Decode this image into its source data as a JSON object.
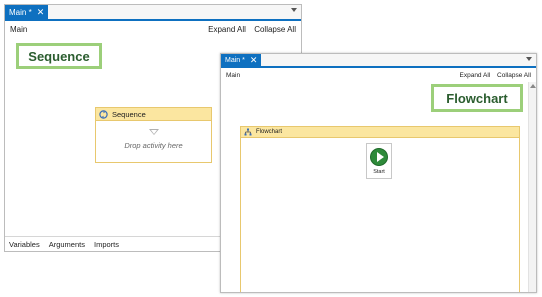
{
  "sequence_window": {
    "tab_label": "Main *",
    "tab_close": "✕",
    "breadcrumb": "Main",
    "expand_all": "Expand All",
    "collapse_all": "Collapse All",
    "callout": "Sequence",
    "activity": {
      "title": "Sequence",
      "placeholder": "Drop activity here"
    },
    "bottom_bar": {
      "variables": "Variables",
      "arguments": "Arguments",
      "imports": "Imports"
    }
  },
  "flowchart_window": {
    "tab_label": "Main *",
    "tab_close": "✕",
    "breadcrumb": "Main",
    "expand_all": "Expand All",
    "collapse_all": "Collapse All",
    "callout": "Flowchart",
    "activity": {
      "title": "Flowchart",
      "start_node_label": "Start"
    }
  },
  "colors": {
    "tab_accent": "#0e70c0",
    "callout_border": "#9ccf7a",
    "callout_text": "#2b5d2f",
    "activity_header": "#fbe6a0",
    "activity_border": "#e8c86e",
    "start_green": "#2e8a3a"
  },
  "icons": {
    "sequence_activity": "sequence-icon",
    "flowchart_activity": "flowchart-icon",
    "pan": "hand-icon",
    "zoom": "magnifier-icon",
    "start": "play-icon"
  }
}
